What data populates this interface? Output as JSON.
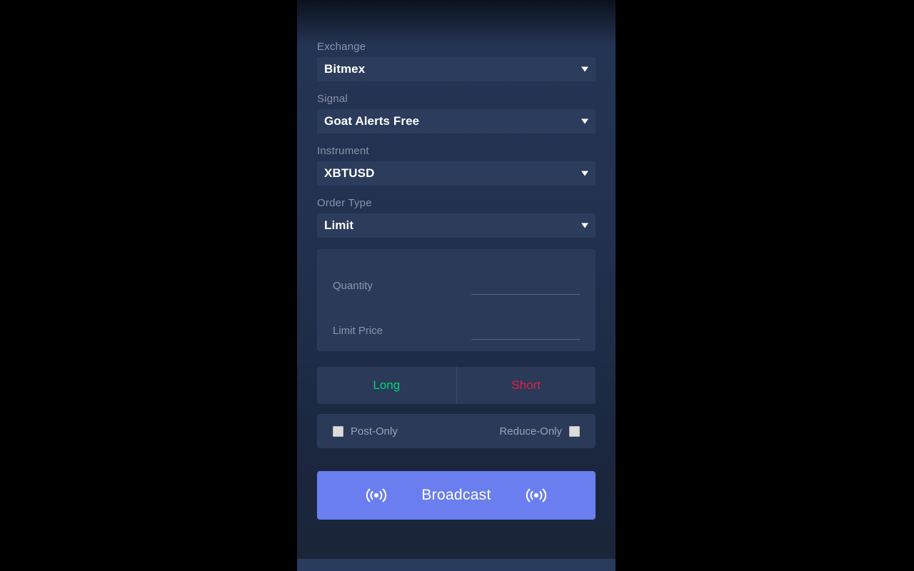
{
  "panel": {
    "fields": [
      {
        "label": "Exchange",
        "value": "Bitmex",
        "icon": "chevron-down-icon"
      },
      {
        "label": "Signal",
        "value": "Goat Alerts Free",
        "icon": "chevron-down-icon"
      },
      {
        "label": "Instrument",
        "value": "XBTUSD",
        "icon": "chevron-down-icon"
      },
      {
        "label": "Order Type",
        "value": "Limit",
        "icon": "chevron-down-icon"
      }
    ],
    "order_inputs": [
      {
        "label": "Quantity",
        "value": "",
        "placeholder": ""
      },
      {
        "label": "Limit Price",
        "value": "",
        "placeholder": ""
      }
    ],
    "sides": {
      "long_label": "Long",
      "short_label": "Short",
      "long_color": "#00d67a",
      "short_color": "#e0214a"
    },
    "options": [
      {
        "label": "Post-Only",
        "checked": false,
        "checkbox_position": "left"
      },
      {
        "label": "Reduce-Only",
        "checked": false,
        "checkbox_position": "right"
      }
    ],
    "broadcast": {
      "label": "Broadcast",
      "left_icon": "broadcast-icon",
      "right_icon": "broadcast-icon",
      "color": "#6b7ef0"
    }
  }
}
